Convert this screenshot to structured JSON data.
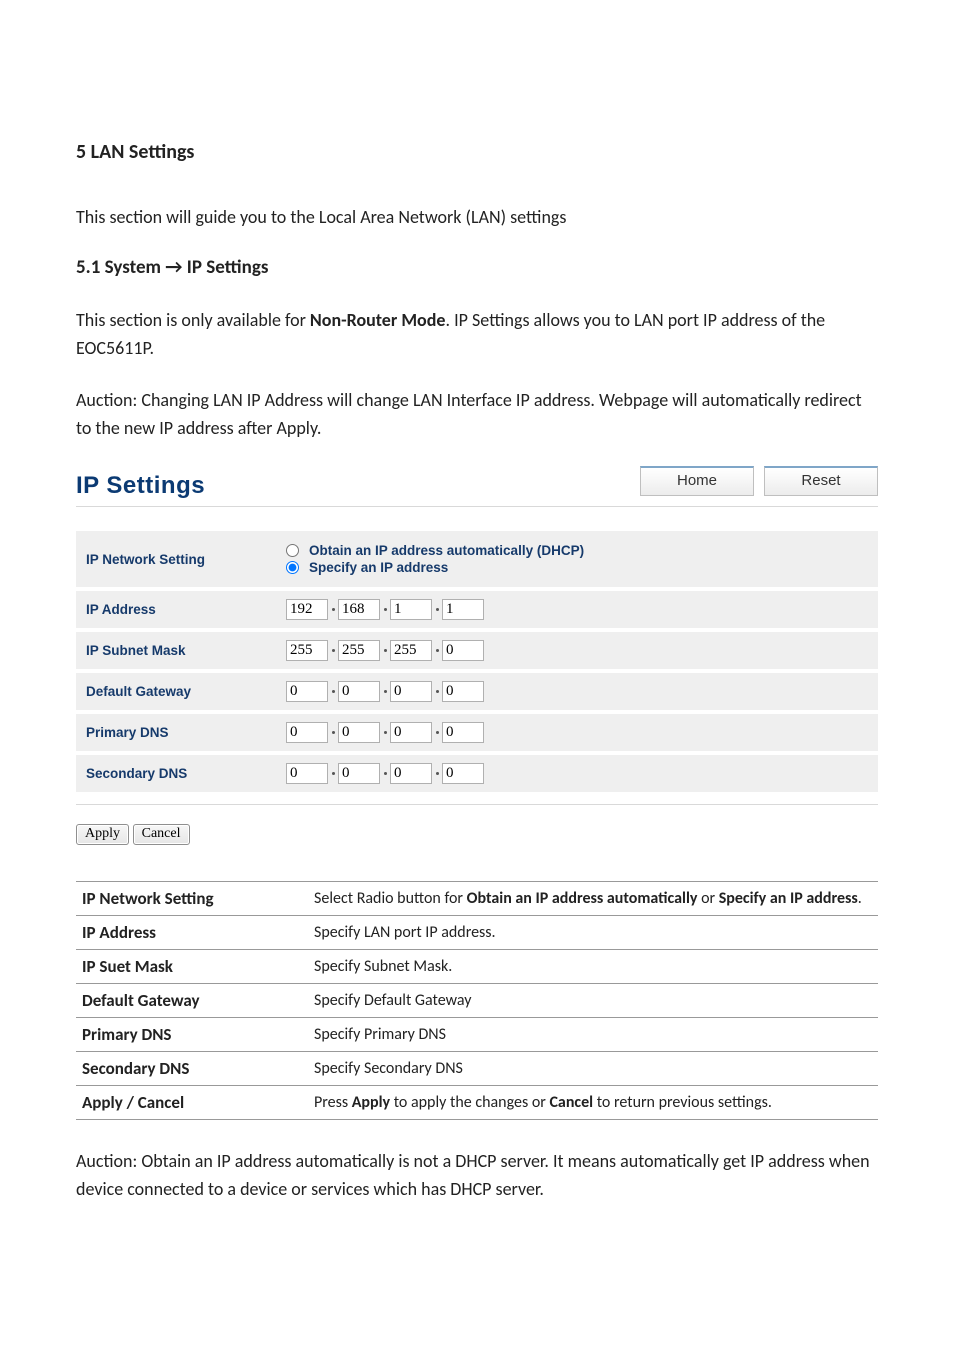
{
  "headings": {
    "h5": "5 LAN Settings",
    "intro": "This section will guide you to the Local Area Network (LAN) settings",
    "h51": "5.1 System → IP Settings",
    "para2_pre": "This section is only available for ",
    "para2_bold": "Non-Router Mode",
    "para2_post": ". IP Settings allows you to LAN port IP address of the EOC5611P.",
    "para3": "Auction: Changing LAN IP Address will change LAN Interface IP address. Webpage will automatically redirect to the new IP address after Apply."
  },
  "panel": {
    "title": "IP Settings",
    "home": "Home",
    "reset": "Reset",
    "rows": {
      "network_setting": "IP Network Setting",
      "ip_address": "IP Address",
      "subnet": "IP Subnet Mask",
      "gateway": "Default Gateway",
      "pdns": "Primary DNS",
      "sdns": "Secondary DNS"
    },
    "radio1": "Obtain an IP address automatically (DHCP)",
    "radio2": "Specify an IP address",
    "ip": [
      "192",
      "168",
      "1",
      "1"
    ],
    "mask": [
      "255",
      "255",
      "255",
      "0"
    ],
    "gw": [
      "0",
      "0",
      "0",
      "0"
    ],
    "dns1": [
      "0",
      "0",
      "0",
      "0"
    ],
    "dns2": [
      "0",
      "0",
      "0",
      "0"
    ],
    "apply": "Apply",
    "cancel": "Cancel"
  },
  "desc": {
    "r1t": "IP Network Setting",
    "r1d_pre": "Select Radio button for ",
    "r1d_b1": "Obtain an IP address automatically",
    "r1d_mid": " or ",
    "r1d_b2": "Specify an IP address",
    "r1d_post": ".",
    "r2t": "IP Address",
    "r2d": "Specify LAN port IP address.",
    "r3t": "IP Suet Mask",
    "r3d": "Specify Subnet Mask.",
    "r4t": "Default Gateway",
    "r4d": "Specify Default Gateway",
    "r5t": "Primary DNS",
    "r5d": "Specify Primary DNS",
    "r6t": "Secondary DNS",
    "r6d": "Specify Secondary DNS",
    "r7t": "Apply / Cancel",
    "r7d_pre": "Press ",
    "r7d_b1": "Apply",
    "r7d_mid": " to apply the changes or ",
    "r7d_b2": "Cancel",
    "r7d_post": " to return previous settings."
  },
  "footer": "Auction: Obtain an IP address automatically is not a DHCP server. It means automatically get IP address when device connected to a device or services which has DHCP server."
}
